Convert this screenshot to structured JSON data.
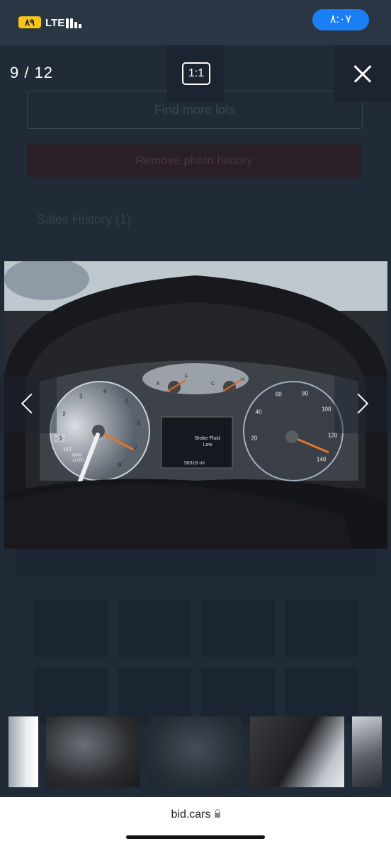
{
  "status_bar": {
    "battery": "۸۹",
    "network": "LTE",
    "time": "۸:۰۷"
  },
  "viewer": {
    "counter": "9 / 12",
    "zoom_label": "1:1"
  },
  "background_page": {
    "box_text": "Find more lots",
    "button_text": "Remove photo history",
    "sales_heading": "Sales History (1)"
  },
  "dashboard": {
    "tach": [
      "1",
      "2",
      "3",
      "4",
      "5",
      "6",
      "7",
      "8"
    ],
    "speed": [
      "20",
      "40",
      "60",
      "80",
      "100",
      "120",
      "140"
    ],
    "auto_stop": "AUTO STOP",
    "auto_off": "OFF",
    "rpm": "RPM x1000",
    "message": "Brake Fluid Low",
    "odometer": "58318 mi",
    "fuel_e": "E",
    "fuel_f": "F",
    "temp_c": "C",
    "temp_h": "H"
  },
  "footer": {
    "url": "bid.cars"
  }
}
